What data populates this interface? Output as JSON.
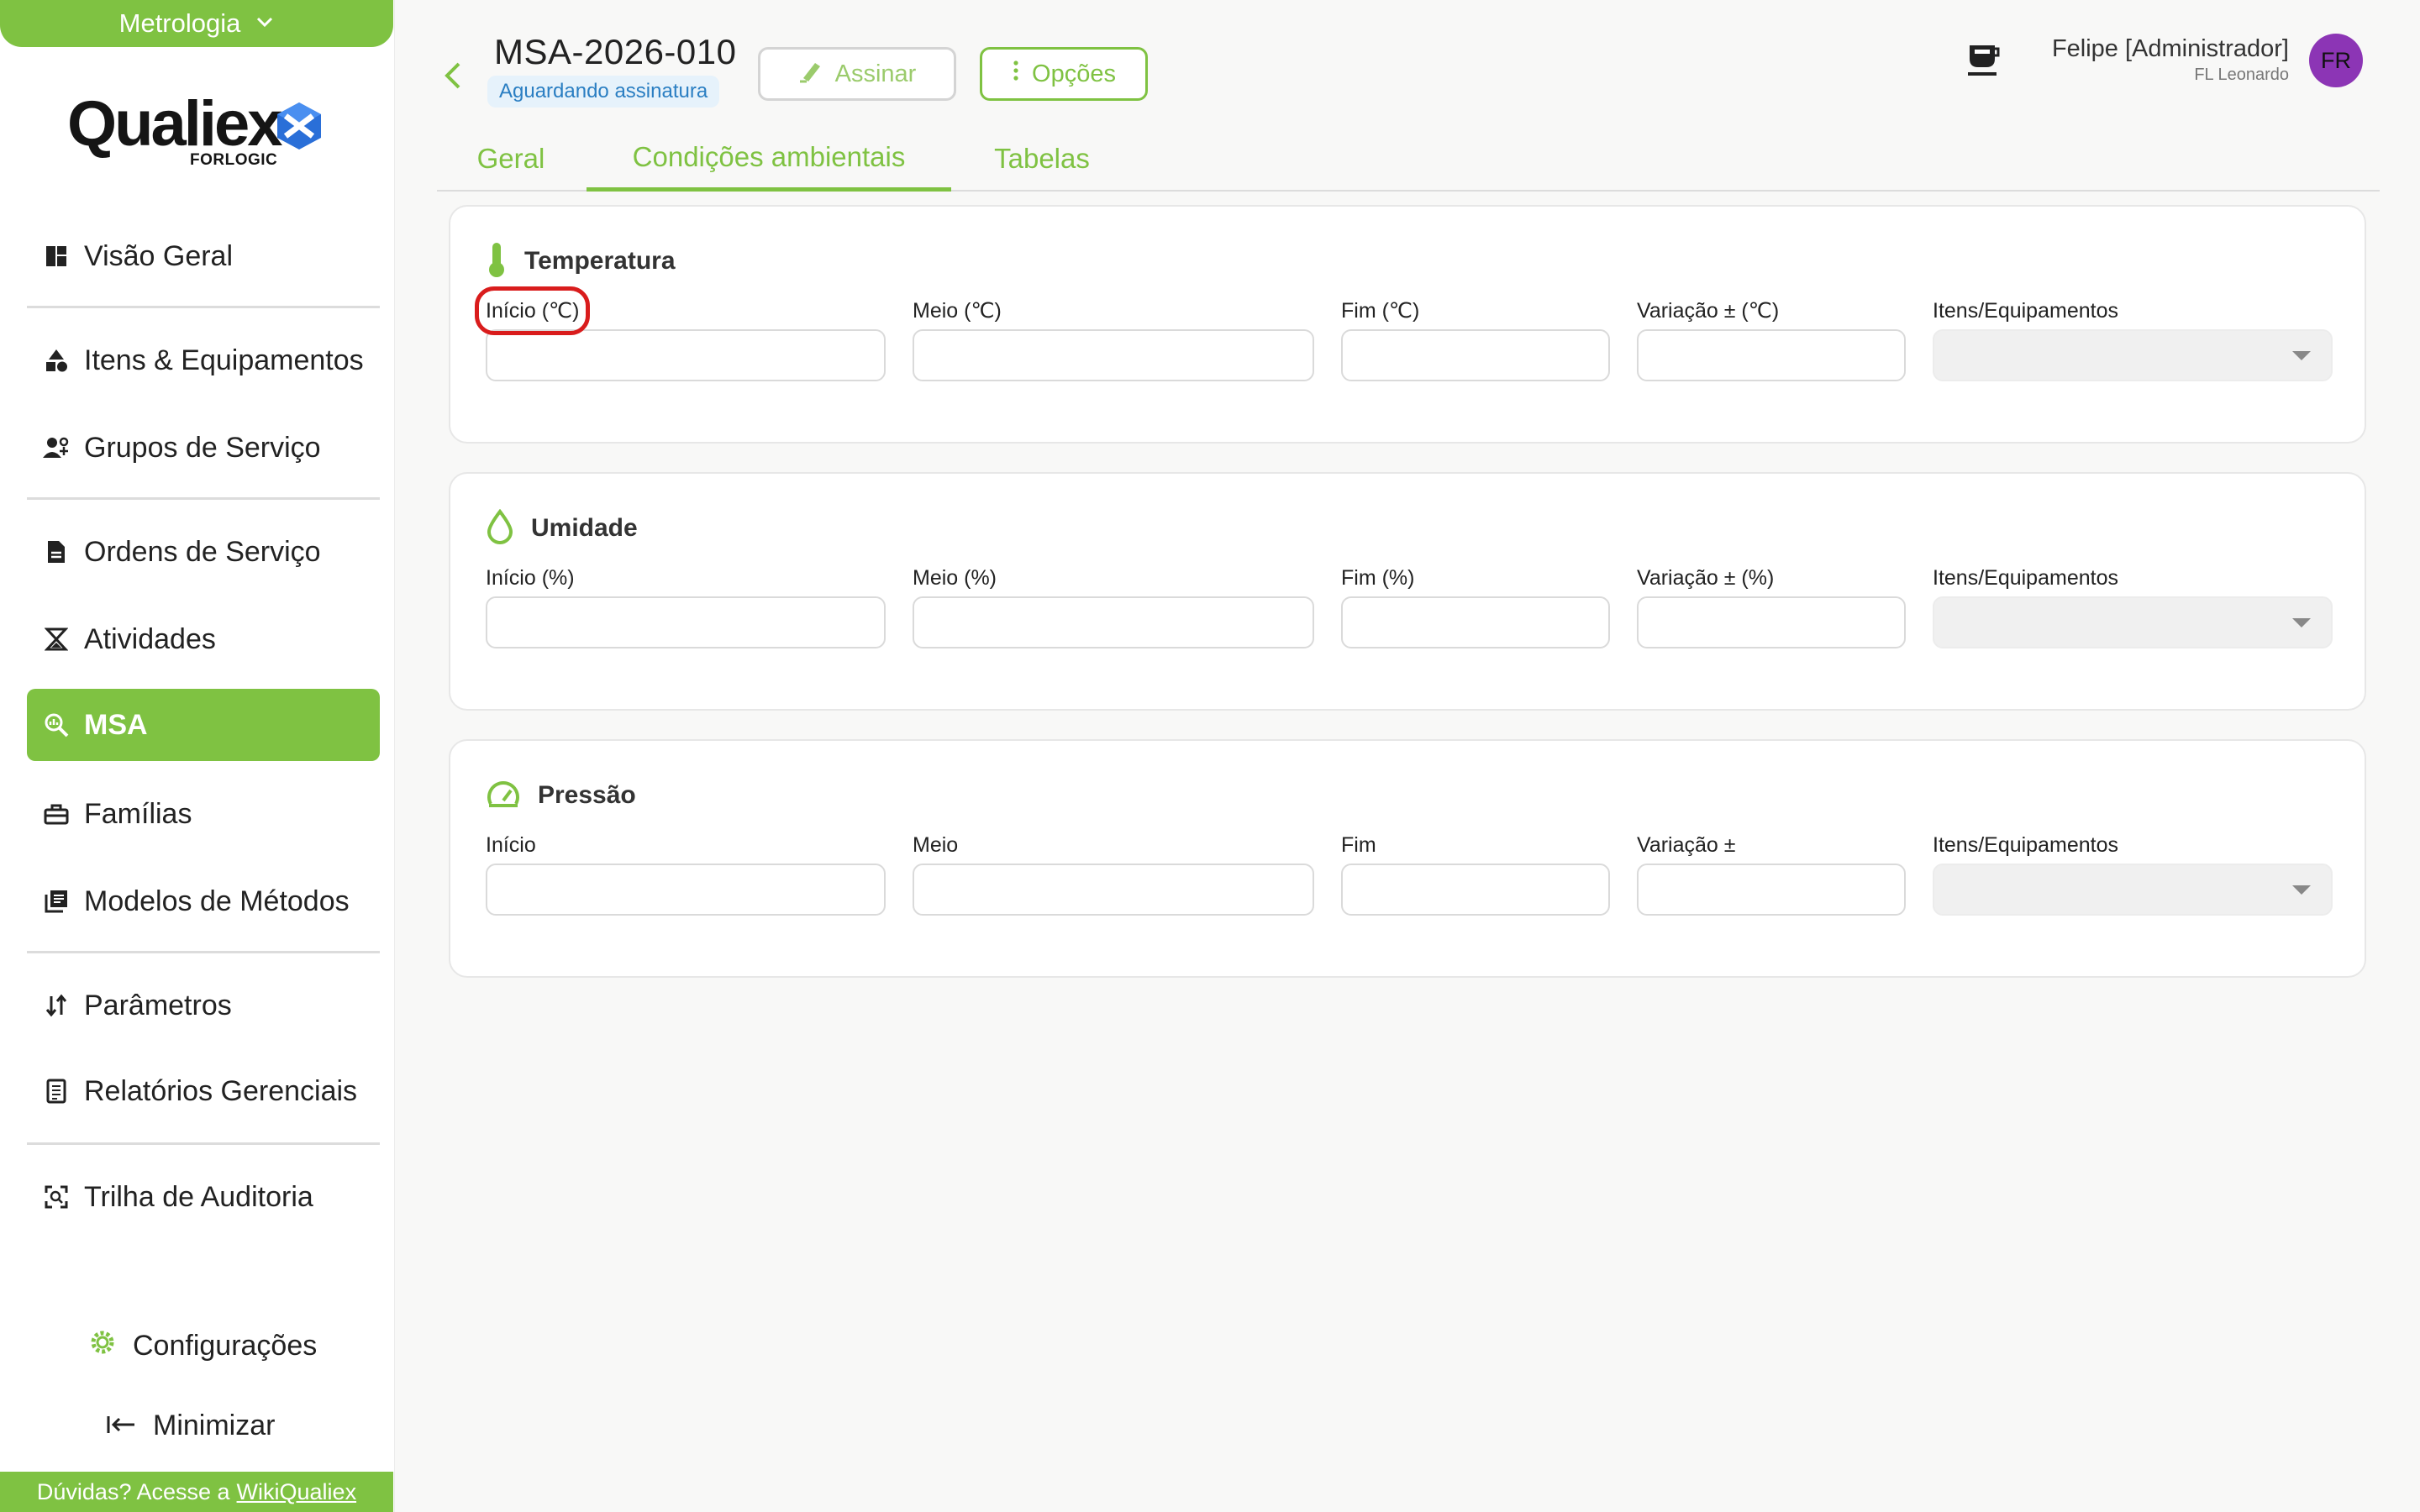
{
  "sidebar": {
    "module": "Metrologia",
    "logo": {
      "name": "Qualiex",
      "sub": "FORLOGIC"
    },
    "items": [
      {
        "label": "Visão Geral",
        "icon": "dashboard-icon"
      },
      {
        "label": "Itens & Equipamentos",
        "icon": "shapes-icon"
      },
      {
        "label": "Grupos de Serviço",
        "icon": "users-group-icon"
      },
      {
        "label": "Ordens de Serviço",
        "icon": "document-icon"
      },
      {
        "label": "Atividades",
        "icon": "hourglass-icon"
      },
      {
        "label": "MSA",
        "icon": "zoom-analysis-icon"
      },
      {
        "label": "Famílias",
        "icon": "toolbox-icon"
      },
      {
        "label": "Modelos de Métodos",
        "icon": "library-icon"
      },
      {
        "label": "Parâmetros",
        "icon": "sort-arrows-icon"
      },
      {
        "label": "Relatórios Gerenciais",
        "icon": "report-icon"
      },
      {
        "label": "Trilha de Auditoria",
        "icon": "audit-scan-icon"
      }
    ],
    "active_item": "MSA",
    "settings_label": "Configurações",
    "minimize_label": "Minimizar",
    "help_text": "Dúvidas? Acesse a",
    "help_link": "WikiQualiex"
  },
  "header": {
    "title": "MSA-2026-010",
    "status": "Aguardando assinatura",
    "sign_label": "Assinar",
    "options_label": "Opções",
    "user_name": "Felipe [Administrador]",
    "user_org": "FL Leonardo",
    "avatar_initials": "FR"
  },
  "tabs": [
    {
      "label": "Geral"
    },
    {
      "label": "Condições ambientais"
    },
    {
      "label": "Tabelas"
    }
  ],
  "active_tab": "Condições ambientais",
  "sections": {
    "temperature": {
      "title": "Temperatura",
      "labels": {
        "start": "Início (℃)",
        "mid": "Meio (℃)",
        "end": "Fim (℃)",
        "variation": "Variação ± (℃)",
        "items": "Itens/Equipamentos"
      }
    },
    "humidity": {
      "title": "Umidade",
      "labels": {
        "start": "Início (%)",
        "mid": "Meio (%)",
        "end": "Fim (%)",
        "variation": "Variação ± (%)",
        "items": "Itens/Equipamentos"
      }
    },
    "pressure": {
      "title": "Pressão",
      "labels": {
        "start": "Início",
        "mid": "Meio",
        "end": "Fim",
        "variation": "Variação ±",
        "items": "Itens/Equipamentos"
      }
    }
  },
  "colors": {
    "accent": "#7fc242",
    "badge_bg": "#e6f2fb",
    "badge_text": "#2a7ec2",
    "avatar": "#8c35b5",
    "highlight": "#d91c1c"
  }
}
